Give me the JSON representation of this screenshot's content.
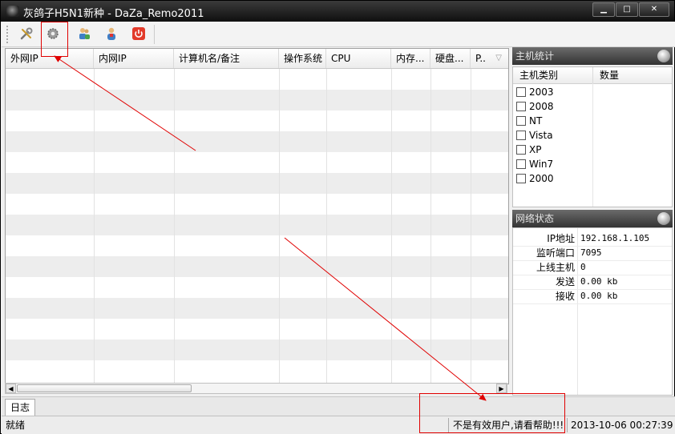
{
  "window": {
    "title": "灰鸽子H5N1新种 - DaZa_Remo2011",
    "controls": {
      "minimize": "▁",
      "maximize": "□",
      "close": "✕"
    }
  },
  "toolbar": {
    "buttons": [
      {
        "name": "tools-button",
        "icon": "wrench-icon"
      },
      {
        "name": "settings-button",
        "icon": "gear-icon"
      },
      {
        "name": "user-group-button",
        "icon": "users-icon"
      },
      {
        "name": "user-button",
        "icon": "user-icon"
      },
      {
        "name": "power-button",
        "icon": "power-icon"
      }
    ]
  },
  "host_table": {
    "columns": [
      "外网IP",
      "内网IP",
      "计算机名/备注",
      "操作系统",
      "CPU",
      "内存...",
      "硬盘...",
      "P.."
    ],
    "rows": []
  },
  "host_stats": {
    "title": "主机统计",
    "columns": [
      "主机类别",
      "数量"
    ],
    "items": [
      "2003",
      "2008",
      "NT",
      "Vista",
      "XP",
      "Win7",
      "2000"
    ]
  },
  "net_status": {
    "title": "网络状态",
    "rows": [
      {
        "label": "IP地址",
        "value": "192.168.1.105"
      },
      {
        "label": "监听端口",
        "value": "7095"
      },
      {
        "label": "上线主机",
        "value": "0"
      },
      {
        "label": "发送",
        "value": "0.00 kb"
      },
      {
        "label": "接收",
        "value": "0.00 kb"
      }
    ]
  },
  "log": {
    "tab_label": "日志"
  },
  "status_bar": {
    "state": "就绪",
    "message": "不是有效用户,请看帮助!!!",
    "datetime": "2013-10-06 00:27:39"
  },
  "colors": {
    "annotation": "#e00000",
    "title_bar": "#1f1f1f",
    "row_alt": "#ededed"
  }
}
